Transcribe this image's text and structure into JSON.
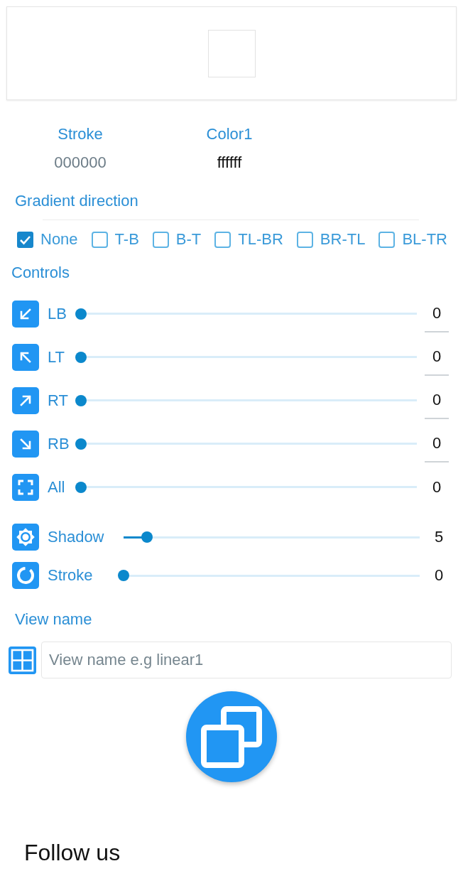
{
  "colors": [
    {
      "label": "Stroke",
      "placeholder": "000000"
    },
    {
      "label": "Color1",
      "value": "ffffff"
    }
  ],
  "gradient_direction": {
    "title": "Gradient direction",
    "options": [
      {
        "label": "None",
        "checked": true
      },
      {
        "label": "T-B",
        "checked": false
      },
      {
        "label": "B-T",
        "checked": false
      },
      {
        "label": "TL-BR",
        "checked": false
      },
      {
        "label": "BR-TL",
        "checked": false
      },
      {
        "label": "BL-TR",
        "checked": false
      }
    ]
  },
  "controls": {
    "title": "Controls",
    "corners": [
      {
        "label": "LB",
        "level": 0,
        "value": "0",
        "kind": "field"
      },
      {
        "label": "LT",
        "level": 0,
        "value": "0",
        "kind": "field"
      },
      {
        "label": "RT",
        "level": 0,
        "value": "0",
        "kind": "field"
      },
      {
        "label": "RB",
        "level": 0,
        "value": "0",
        "kind": "field"
      },
      {
        "label": "All",
        "level": 0,
        "value": "0",
        "kind": "text"
      }
    ],
    "effects": [
      {
        "label": "Shadow",
        "level": 0.08,
        "value": "5"
      },
      {
        "label": "Stroke",
        "level": 0,
        "value": "0"
      }
    ]
  },
  "view_name": {
    "title": "View name",
    "placeholder": "View name e.g linear1"
  },
  "footer": {
    "title": "Follow us"
  }
}
